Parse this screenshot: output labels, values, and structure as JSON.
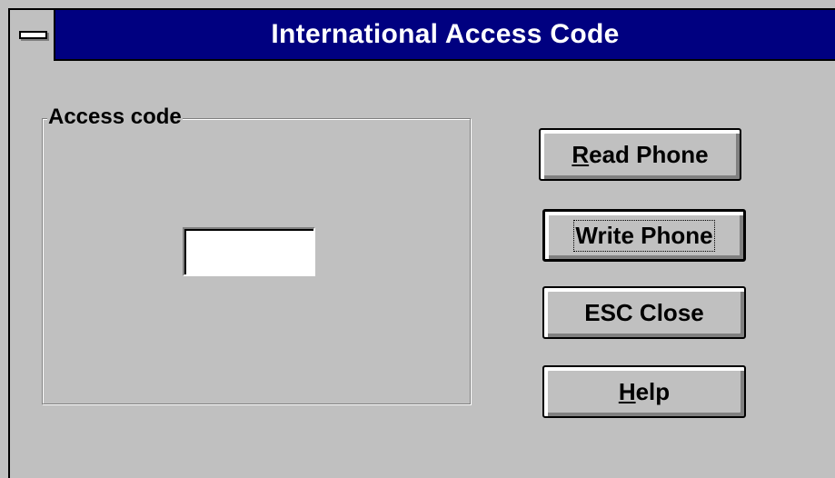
{
  "window": {
    "title": "International Access Code"
  },
  "group": {
    "label": "Access code"
  },
  "access_code_input": {
    "value": ""
  },
  "buttons": {
    "read_phone": {
      "accel": "R",
      "rest": "ead Phone"
    },
    "write_phone": {
      "label": "Write Phone"
    },
    "esc_close": {
      "label": "ESC Close"
    },
    "help": {
      "accel": "H",
      "rest": "elp"
    }
  },
  "colors": {
    "title_bar": "#000080",
    "face": "#c0c0c0"
  }
}
